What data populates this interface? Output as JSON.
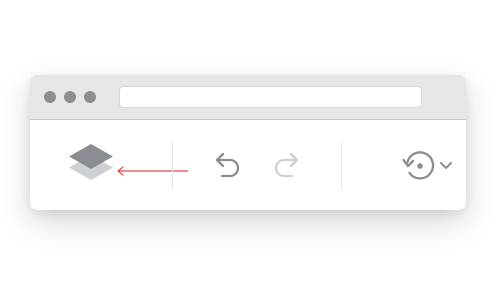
{
  "window": {
    "address_bar": {
      "value": ""
    }
  },
  "toolbar": {
    "items": [
      {
        "icon": "layers-icon"
      },
      {
        "icon": "undo-icon",
        "state": "enabled"
      },
      {
        "icon": "redo-icon",
        "state": "disabled"
      },
      {
        "icon": "history-icon",
        "has_dropdown": true
      }
    ]
  },
  "annotation": {
    "type": "arrow",
    "points_to": "layers-icon",
    "color": "#e8474c"
  },
  "colors": {
    "titlebar": "#e6e6e6",
    "window_controls": "#8e8e8e",
    "icon_active": "#8a8d91",
    "icon_disabled": "#cdd0d3",
    "annotation": "#e8474c"
  }
}
